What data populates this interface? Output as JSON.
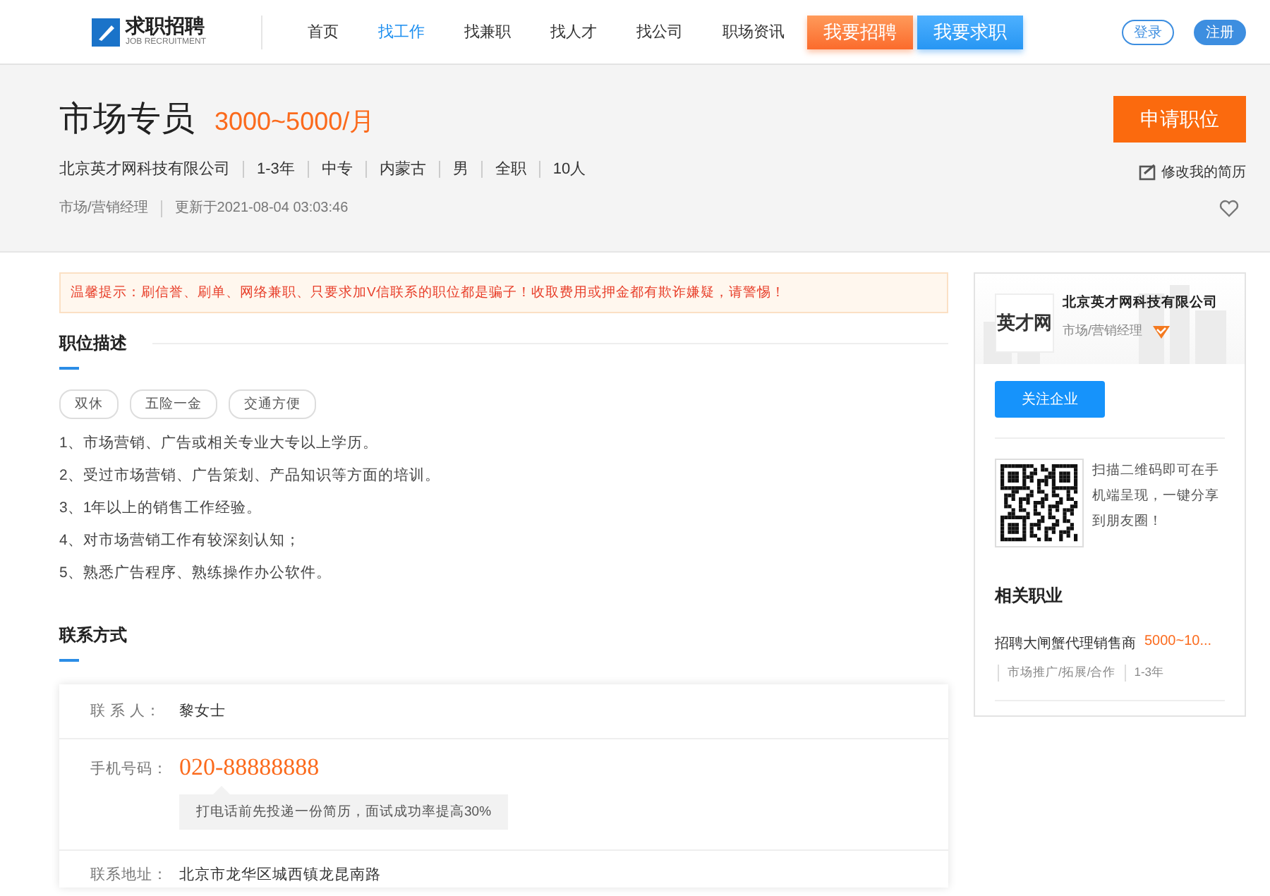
{
  "header": {
    "logo": {
      "title": "求职招聘",
      "subtitle": "JOB RECRUITMENT"
    },
    "nav": [
      {
        "label": "首页",
        "selected": false
      },
      {
        "label": "找工作",
        "selected": true
      },
      {
        "label": "找兼职",
        "selected": false
      },
      {
        "label": "找人才",
        "selected": false
      },
      {
        "label": "找公司",
        "selected": false
      },
      {
        "label": "职场资讯",
        "selected": false
      }
    ],
    "actions": [
      {
        "label": "我要招聘",
        "kind": "orange"
      },
      {
        "label": "我要求职",
        "kind": "blue"
      }
    ],
    "auth": [
      {
        "label": "登录",
        "kind": "outline"
      },
      {
        "label": "注册",
        "kind": "filled"
      }
    ]
  },
  "job": {
    "title": "市场专员",
    "salary": "3000~5000/月",
    "meta": [
      "北京英才网科技有限公司",
      "1-3年",
      "中专",
      "内蒙古",
      "男",
      "全职",
      "10人"
    ],
    "category": "市场/营销经理",
    "updated": "更新于2021-08-04 03:03:46",
    "apply_button": "申请职位",
    "edit_resume": "修改我的简历"
  },
  "notice": "温馨提示：刷信誉、刷单、网络兼职、只要求加V信联系的职位都是骗子！收取费用或押金都有欺诈嫌疑，请警惕！",
  "description": {
    "heading": "职位描述",
    "tags": [
      "双休",
      "五险一金",
      "交通方便"
    ],
    "items": [
      "1、市场营销、广告或相关专业大专以上学历。",
      "2、受过市场营销、广告策划、产品知识等方面的培训。",
      "3、1年以上的销售工作经验。",
      "4、对市场营销工作有较深刻认知；",
      "5、熟悉广告程序、熟练操作办公软件。"
    ]
  },
  "contact": {
    "heading": "联系方式",
    "rows": [
      {
        "kind": "plain",
        "label": "联 系 人：",
        "value": "黎女士"
      },
      {
        "kind": "phone",
        "label": "手机号码：",
        "value": "020-88888888",
        "tip": "打电话前先投递一份简历，面试成功率提高30%"
      },
      {
        "kind": "plain",
        "label": "联系地址：",
        "value": "北京市龙华区城西镇龙昆南路"
      }
    ]
  },
  "company": {
    "logo_text": "英才网",
    "name": "北京英才网科技有限公司",
    "category": "市场/营销经理",
    "verified": true,
    "follow_button": "关注企业",
    "qr_text": "扫描二维码即可在手机端呈现，一键分享到朋友圈！"
  },
  "related": {
    "heading": "相关职业",
    "jobs": [
      {
        "title": "招聘大闸蟹代理销售商",
        "salary": "5000~10...",
        "category": "市场推广/拓展/合作",
        "experience": "1-3年"
      }
    ]
  }
}
